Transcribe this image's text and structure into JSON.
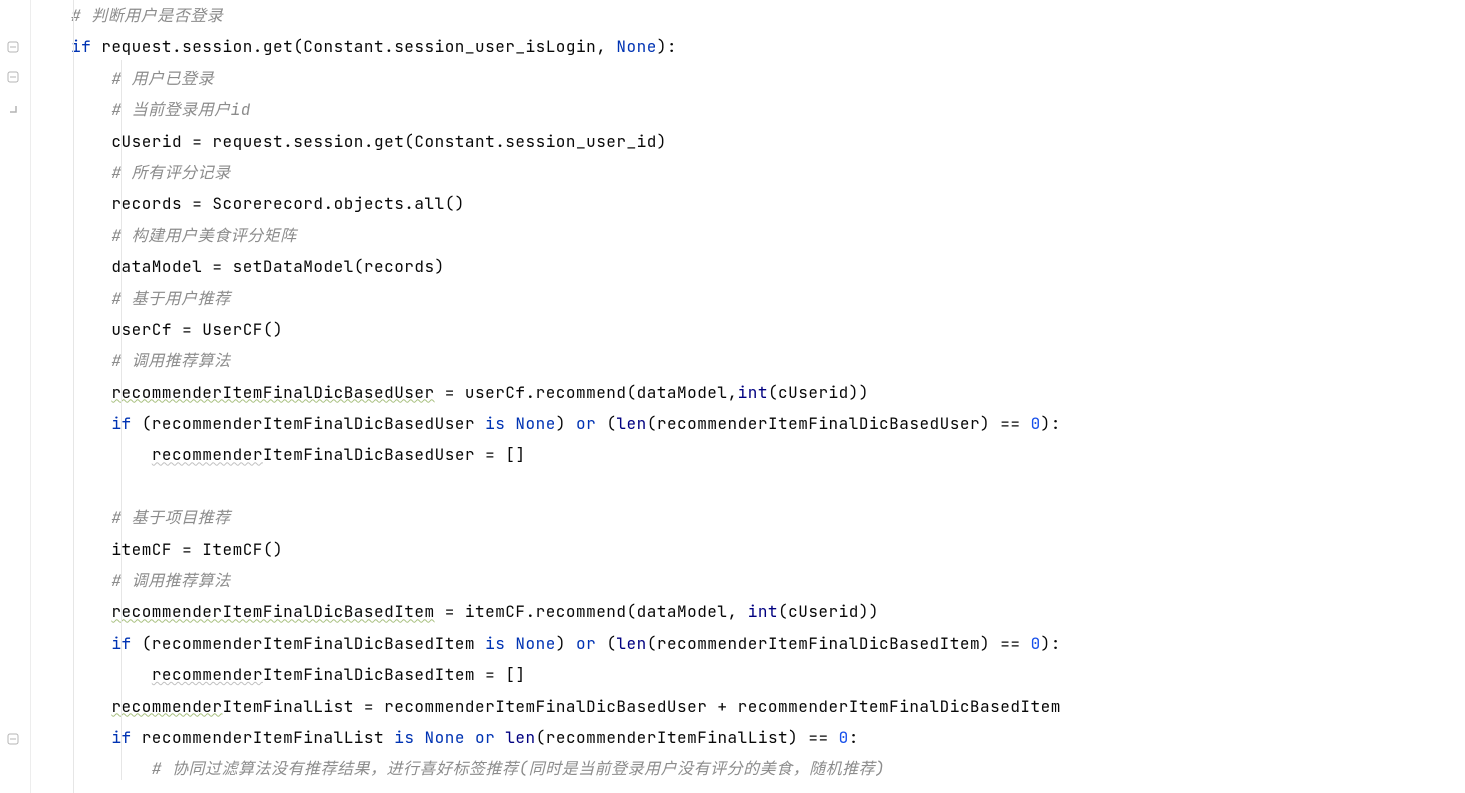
{
  "code": {
    "l1": {
      "c": "# 判断用户是否登录"
    },
    "l2": {
      "kw1": "if",
      "p1": " request.session.get(Constant.session_user_isLogin, ",
      "kw2": "None",
      "p2": "):"
    },
    "l3": {
      "c": "# 用户已登录"
    },
    "l4": {
      "c": "# 当前登录用户id"
    },
    "l5": {
      "t": "cUserid = request.session.get(Constant.session_user_id)"
    },
    "l6": {
      "c": "# 所有评分记录"
    },
    "l7": {
      "t": "records = Scorerecord.objects.all()"
    },
    "l8": {
      "c": "# 构建用户美食评分矩阵"
    },
    "l9": {
      "t": "dataModel = setDataModel(records)"
    },
    "l10": {
      "c": "# 基于用户推荐"
    },
    "l11": {
      "t": "userCf = UserCF()"
    },
    "l12": {
      "c": "# 调用推荐算法"
    },
    "l13": {
      "w": "recommenderItemFinalDicBasedUser",
      "t": " = userCf.recommend(dataModel,",
      "b": "int",
      "t2": "(cUserid))"
    },
    "l14": {
      "kw1": "if",
      "p1": " (recommenderItemFinalDicBasedUser ",
      "kw2": "is None",
      "p2": ") ",
      "kw3": "or",
      "p3": " (",
      "b": "len",
      "p4": "(recommenderItemFinalDicBasedUser) == ",
      "n": "0",
      "p5": "):"
    },
    "l15": {
      "u": "recommender",
      "t": "ItemFinalDicBasedUser = []"
    },
    "l17": {
      "c": "# 基于项目推荐"
    },
    "l18": {
      "t": "itemCF = ItemCF()"
    },
    "l19": {
      "c": "# 调用推荐算法"
    },
    "l20": {
      "w": "recommenderItemFinalDicBasedItem",
      "t": " = itemCF.recommend(dataModel, ",
      "b": "int",
      "t2": "(cUserid))"
    },
    "l21": {
      "kw1": "if",
      "p1": " (recommenderItemFinalDicBasedItem ",
      "kw2": "is None",
      "p2": ") ",
      "kw3": "or",
      "p3": " (",
      "b": "len",
      "p4": "(recommenderItemFinalDicBasedItem) == ",
      "n": "0",
      "p5": "):"
    },
    "l22": {
      "u": "recommender",
      "t": "ItemFinalDicBasedItem = []"
    },
    "l23": {
      "w": "recommender",
      "t1": "ItemFinalList = recommenderItemFinalDicBasedUser + recommenderItemFinalDicBasedItem"
    },
    "l24": {
      "kw1": "if",
      "p1": " recommenderItemFinalList ",
      "kw2": "is None or ",
      "b": "len",
      "p2": "(recommenderItemFinalList) == ",
      "n": "0",
      "p3": ":"
    },
    "l25": {
      "c": "# 协同过滤算法没有推荐结果，进行喜好标签推荐(同时是当前登录用户没有评分的美食，随机推荐)"
    }
  }
}
